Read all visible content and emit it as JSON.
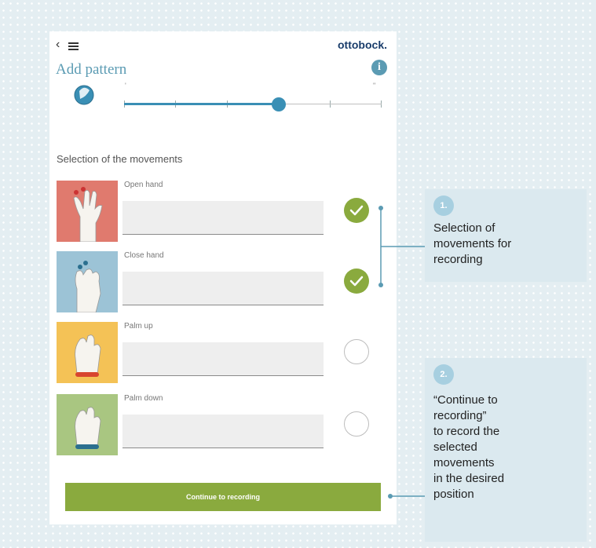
{
  "header": {
    "back_glyph": "‹",
    "brand": "ottobock.",
    "title": "Add pattern",
    "info_glyph": "i"
  },
  "slider": {
    "left_tick_label": "'",
    "right_tick_label": "\"",
    "level_fraction": 0.6,
    "tick_count": 6,
    "color": "#3a8fb5"
  },
  "section_heading": "Selection of the movements",
  "movements": [
    {
      "label": "Open hand",
      "selected": true,
      "tile_color": "#e07a6e",
      "icon": "open-hand-icon"
    },
    {
      "label": "Close hand",
      "selected": true,
      "tile_color": "#9cc3d6",
      "icon": "close-hand-icon"
    },
    {
      "label": "Palm up",
      "selected": false,
      "tile_color": "#f4c256",
      "icon": "palm-up-icon"
    },
    {
      "label": "Palm down",
      "selected": false,
      "tile_color": "#a9c681",
      "icon": "palm-down-icon"
    }
  ],
  "continue_label": "Continue to recording",
  "annotations": [
    {
      "number": "1.",
      "lines": [
        "Selection of",
        "movements for",
        "recording"
      ]
    },
    {
      "number": "2.",
      "lines": [
        "“Continue to",
        "recording”",
        "to record the",
        "selected",
        "movements",
        "in the desired",
        "position"
      ]
    }
  ],
  "colors": {
    "accent_green": "#8aaa3e",
    "accent_blue": "#5b9bb3",
    "annotation_panel": "#dbe9ef",
    "badge": "#a7cfe0"
  }
}
